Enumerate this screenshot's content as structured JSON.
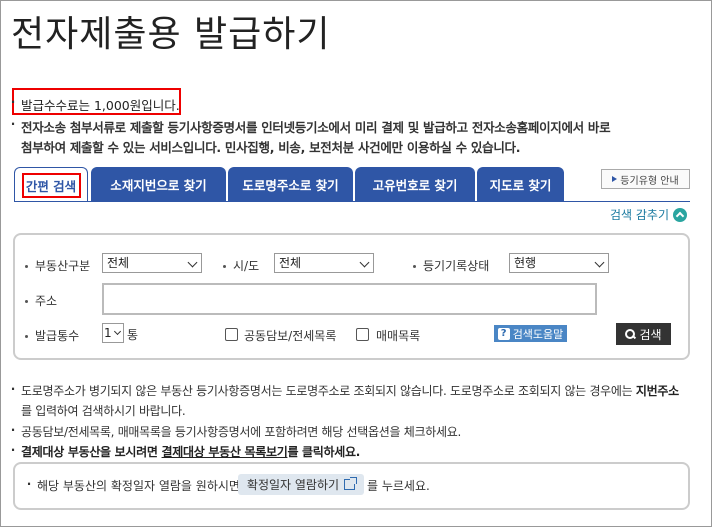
{
  "page": {
    "title": "전자제출용 발급하기"
  },
  "notice": {
    "fee": "발급수수료는 1,000원입니다.",
    "desc_line1": "전자소송 첨부서류로 제출할 등기사항증명서를 인터넷등기소에서 미리 결제 및 발급하고 전자소송홈페이지에서 바로",
    "desc_line2": "첨부하여 제출할 수 있는 서비스입니다. 민사집행, 비송, 보전처분 사건에만 이용하실 수 있습니다."
  },
  "tabs": [
    {
      "label": "간편 검색"
    },
    {
      "label": "소재지번으로 찾기"
    },
    {
      "label": "도로명주소로 찾기"
    },
    {
      "label": "고유번호로 찾기"
    },
    {
      "label": "지도로 찾기"
    }
  ],
  "guide_button": "등기유형 안내",
  "collapse_link": "검색 감추기",
  "search": {
    "property_type": {
      "label": "부동산구분",
      "value": "전체"
    },
    "city": {
      "label": "시/도",
      "value": "전체"
    },
    "record_status": {
      "label": "등기기록상태",
      "value": "현행"
    },
    "address": {
      "label": "주소",
      "value": ""
    },
    "copies": {
      "label": "발급통수",
      "value": "1",
      "unit": "통"
    },
    "joint_collateral": "공동담보/전세목록",
    "sale_list": "매매목록",
    "help_button": "검색도움말",
    "search_button": "검색"
  },
  "bottom_notes": {
    "line1a": "도로명주소가 병기되지 않은 부동산 등기사항증명서는 도로명주소로 조회되지 않습니다. 도로명주소로 조회되지 않는 경우에는",
    "line1b": "지번주소",
    "line1c": "를 입력하여 검색하시기 바랍니다.",
    "line2": "공동담보/전세목록, 매매목록을 등기사항증명서에 포함하려면 해당 선택옵션을 체크하세요.",
    "line3a": "결제대상 부동산을 보시려면",
    "line3_link": "결제대상 부동산 목록보기",
    "line3b": "를 클릭하세요."
  },
  "confirm": {
    "text_before": "해당 부동산의 확정일자 열람을 원하시면",
    "button": "확정일자 열람하기",
    "text_after": "를 누르세요."
  },
  "colors": {
    "tab_blue": "#2f56a6",
    "highlight_red": "#e00000",
    "search_dark": "#333333",
    "help_blue": "#4a86c5"
  }
}
